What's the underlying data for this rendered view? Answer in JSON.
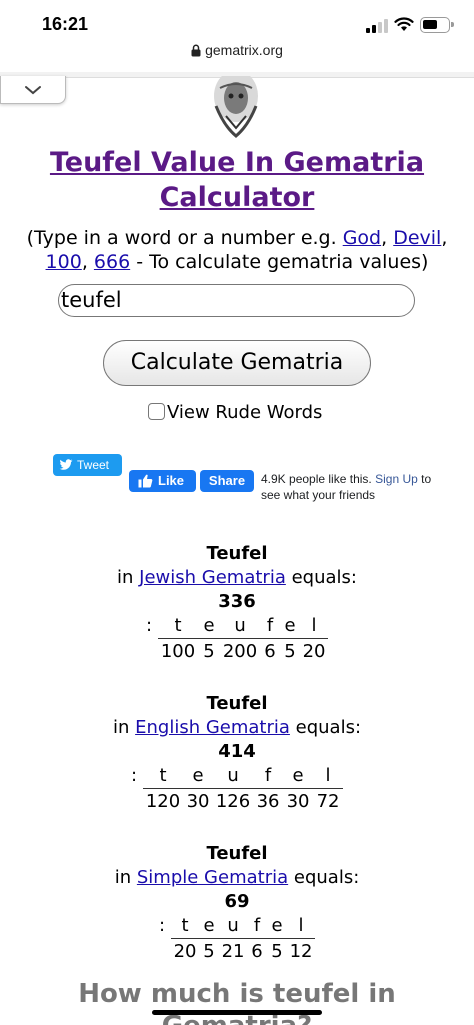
{
  "status": {
    "time": "16:21"
  },
  "browser": {
    "url": "gematrix.org"
  },
  "page": {
    "title": "Teufel Value In Gematria Calculator",
    "intro": {
      "prefix": "(Type in a word or a number e.g.",
      "links": [
        "God",
        "Devil",
        "100",
        "666"
      ],
      "suffix": "- To calculate gematria values)"
    },
    "search_value": "teufel",
    "calculate_label": "Calculate Gematria",
    "rude_label": "View Rude Words"
  },
  "social": {
    "tweet_label": "Tweet",
    "like_label": "Like",
    "share_label": "Share",
    "like_count_text": "4.9K people like this.",
    "signup_link": "Sign Up",
    "signup_suffix": "to see what your friends"
  },
  "results": [
    {
      "word": "Teufel",
      "prefix": "in",
      "system": "Jewish Gematria",
      "suffix": "equals:",
      "total": "336",
      "letters": [
        "t",
        "e",
        "u",
        "f",
        "e",
        "l"
      ],
      "values": [
        "100",
        "5",
        "200",
        "6",
        "5",
        "20"
      ]
    },
    {
      "word": "Teufel",
      "prefix": "in",
      "system": "English Gematria",
      "suffix": "equals:",
      "total": "414",
      "letters": [
        "t",
        "e",
        "u",
        "f",
        "e",
        "l"
      ],
      "values": [
        "120",
        "30",
        "126",
        "36",
        "30",
        "72"
      ]
    },
    {
      "word": "Teufel",
      "prefix": "in",
      "system": "Simple Gematria",
      "suffix": "equals:",
      "total": "69",
      "letters": [
        "t",
        "e",
        "u",
        "f",
        "e",
        "l"
      ],
      "values": [
        "20",
        "5",
        "21",
        "6",
        "5",
        "12"
      ]
    }
  ],
  "bottom_heading": "How much is teufel in Gematria?"
}
